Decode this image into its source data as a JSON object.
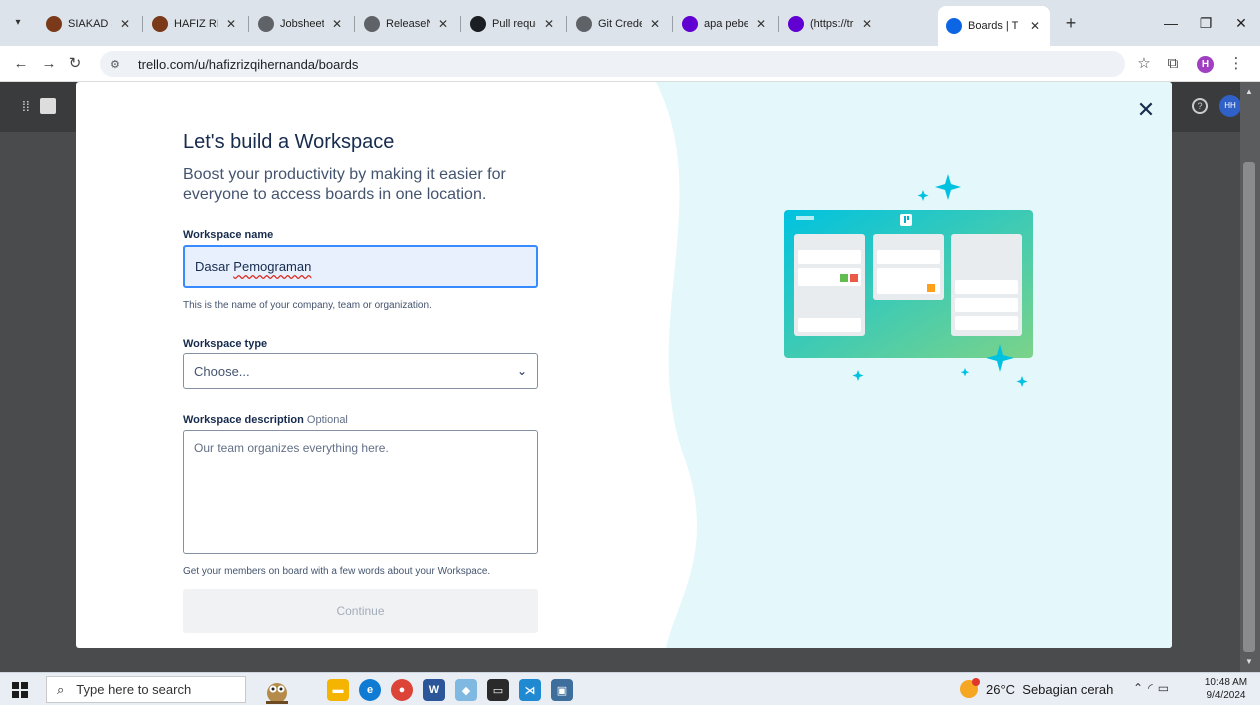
{
  "browser": {
    "tabs": [
      {
        "label": "SIAKAD 3",
        "color": "#7a3a1a"
      },
      {
        "label": "HAFIZ RIZ",
        "color": "#7a3a1a"
      },
      {
        "label": "Jobsheet",
        "color": "#5f6368"
      },
      {
        "label": "ReleaseN",
        "color": "#5f6368"
      },
      {
        "label": "Pull reque",
        "color": "#1b1f23"
      },
      {
        "label": "Git Crede",
        "color": "#5f6368"
      },
      {
        "label": "apa pebe",
        "color": "#6001d2"
      },
      {
        "label": "(https://tr",
        "color": "#6001d2"
      },
      {
        "label": "Boards | T",
        "color": "#0c66e4"
      }
    ],
    "url": "trello.com/u/hafizrizqihernanda/boards",
    "profile_initial": "H"
  },
  "trello": {
    "user_initials": "HH"
  },
  "modal": {
    "heading": "Let's build a Workspace",
    "subheading": "Boost your productivity by making it easier for everyone to access boards in one location.",
    "name_label": "Workspace name",
    "name_value_plain": "Dasar ",
    "name_value_spell": "Pemograman",
    "name_help": "This is the name of your company, team or organization.",
    "type_label": "Workspace type",
    "type_value": "Choose...",
    "desc_label": "Workspace description",
    "desc_optional": "Optional",
    "desc_placeholder": "Our team organizes everything here.",
    "desc_help": "Get your members on board with a few words about your Workspace.",
    "continue_label": "Continue",
    "colors": {
      "accent": "#388bff",
      "art_bg": "#e4f7fb",
      "board_from": "#00c2e0",
      "board_to": "#7bd389"
    }
  },
  "taskbar": {
    "search_placeholder": "Type here to search",
    "weather": "26°C  Sebagian cerah",
    "time": "10:48 AM",
    "date": "9/4/2024"
  }
}
